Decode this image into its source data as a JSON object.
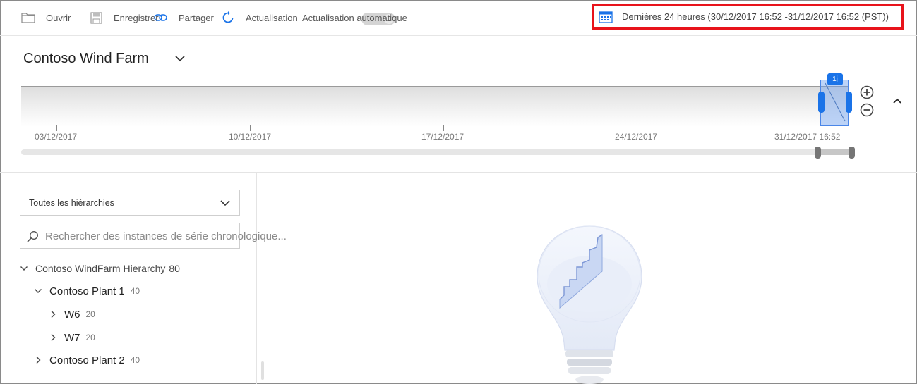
{
  "toolbar": {
    "open_label": "Ouvrir",
    "save_label": "Enregistrer",
    "share_label": "Partager",
    "refresh_label": "Actualisation",
    "auto_refresh_label": "Actualisation automatique",
    "auto_refresh_on": false
  },
  "time_range": {
    "label": "Dernières 24 heures (30/12/2017 16:52 -31/12/2017 16:52 (PST))"
  },
  "environment": {
    "name": "Contoso Wind Farm"
  },
  "timeline": {
    "ticks": [
      "03/12/2017",
      "10/12/2017",
      "17/12/2017",
      "24/12/2017",
      "31/12/2017 16:52"
    ],
    "brush_badge": "1j"
  },
  "hierarchy_panel": {
    "selector_value": "Toutes les hiérarchies",
    "search_placeholder": "Rechercher des instances de série chronologique..."
  },
  "tree": [
    {
      "name": "Contoso WindFarm Hierarchy",
      "count": "80",
      "expanded": true
    },
    {
      "name": "Contoso Plant 1",
      "count": "40",
      "expanded": true
    },
    {
      "name": "W6",
      "count": "20",
      "expanded": false
    },
    {
      "name": "W7",
      "count": "20",
      "expanded": false
    },
    {
      "name": "Contoso Plant 2",
      "count": "40",
      "expanded": false
    }
  ],
  "colors": {
    "accent": "#1a73e8",
    "highlight_border": "#e8131b"
  }
}
